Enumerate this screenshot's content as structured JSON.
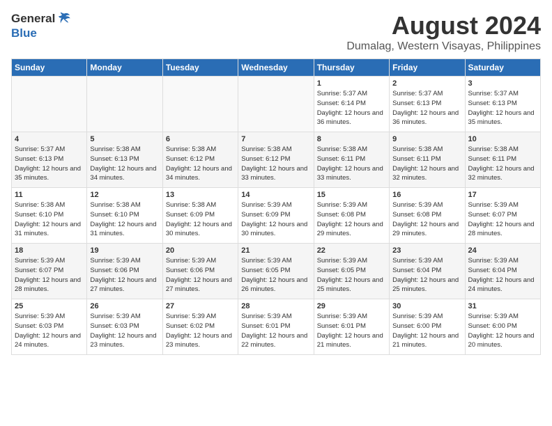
{
  "header": {
    "logo_general": "General",
    "logo_blue": "Blue",
    "title": "August 2024",
    "subtitle": "Dumalag, Western Visayas, Philippines"
  },
  "days_of_week": [
    "Sunday",
    "Monday",
    "Tuesday",
    "Wednesday",
    "Thursday",
    "Friday",
    "Saturday"
  ],
  "weeks": [
    [
      {
        "day": "",
        "empty": true
      },
      {
        "day": "",
        "empty": true
      },
      {
        "day": "",
        "empty": true
      },
      {
        "day": "",
        "empty": true
      },
      {
        "day": "1",
        "sunrise": "5:37 AM",
        "sunset": "6:14 PM",
        "daylight": "12 hours and 36 minutes."
      },
      {
        "day": "2",
        "sunrise": "5:37 AM",
        "sunset": "6:13 PM",
        "daylight": "12 hours and 36 minutes."
      },
      {
        "day": "3",
        "sunrise": "5:37 AM",
        "sunset": "6:13 PM",
        "daylight": "12 hours and 35 minutes."
      }
    ],
    [
      {
        "day": "4",
        "sunrise": "5:37 AM",
        "sunset": "6:13 PM",
        "daylight": "12 hours and 35 minutes."
      },
      {
        "day": "5",
        "sunrise": "5:38 AM",
        "sunset": "6:13 PM",
        "daylight": "12 hours and 34 minutes."
      },
      {
        "day": "6",
        "sunrise": "5:38 AM",
        "sunset": "6:12 PM",
        "daylight": "12 hours and 34 minutes."
      },
      {
        "day": "7",
        "sunrise": "5:38 AM",
        "sunset": "6:12 PM",
        "daylight": "12 hours and 33 minutes."
      },
      {
        "day": "8",
        "sunrise": "5:38 AM",
        "sunset": "6:11 PM",
        "daylight": "12 hours and 33 minutes."
      },
      {
        "day": "9",
        "sunrise": "5:38 AM",
        "sunset": "6:11 PM",
        "daylight": "12 hours and 32 minutes."
      },
      {
        "day": "10",
        "sunrise": "5:38 AM",
        "sunset": "6:11 PM",
        "daylight": "12 hours and 32 minutes."
      }
    ],
    [
      {
        "day": "11",
        "sunrise": "5:38 AM",
        "sunset": "6:10 PM",
        "daylight": "12 hours and 31 minutes."
      },
      {
        "day": "12",
        "sunrise": "5:38 AM",
        "sunset": "6:10 PM",
        "daylight": "12 hours and 31 minutes."
      },
      {
        "day": "13",
        "sunrise": "5:38 AM",
        "sunset": "6:09 PM",
        "daylight": "12 hours and 30 minutes."
      },
      {
        "day": "14",
        "sunrise": "5:39 AM",
        "sunset": "6:09 PM",
        "daylight": "12 hours and 30 minutes."
      },
      {
        "day": "15",
        "sunrise": "5:39 AM",
        "sunset": "6:08 PM",
        "daylight": "12 hours and 29 minutes."
      },
      {
        "day": "16",
        "sunrise": "5:39 AM",
        "sunset": "6:08 PM",
        "daylight": "12 hours and 29 minutes."
      },
      {
        "day": "17",
        "sunrise": "5:39 AM",
        "sunset": "6:07 PM",
        "daylight": "12 hours and 28 minutes."
      }
    ],
    [
      {
        "day": "18",
        "sunrise": "5:39 AM",
        "sunset": "6:07 PM",
        "daylight": "12 hours and 28 minutes."
      },
      {
        "day": "19",
        "sunrise": "5:39 AM",
        "sunset": "6:06 PM",
        "daylight": "12 hours and 27 minutes."
      },
      {
        "day": "20",
        "sunrise": "5:39 AM",
        "sunset": "6:06 PM",
        "daylight": "12 hours and 27 minutes."
      },
      {
        "day": "21",
        "sunrise": "5:39 AM",
        "sunset": "6:05 PM",
        "daylight": "12 hours and 26 minutes."
      },
      {
        "day": "22",
        "sunrise": "5:39 AM",
        "sunset": "6:05 PM",
        "daylight": "12 hours and 25 minutes."
      },
      {
        "day": "23",
        "sunrise": "5:39 AM",
        "sunset": "6:04 PM",
        "daylight": "12 hours and 25 minutes."
      },
      {
        "day": "24",
        "sunrise": "5:39 AM",
        "sunset": "6:04 PM",
        "daylight": "12 hours and 24 minutes."
      }
    ],
    [
      {
        "day": "25",
        "sunrise": "5:39 AM",
        "sunset": "6:03 PM",
        "daylight": "12 hours and 24 minutes."
      },
      {
        "day": "26",
        "sunrise": "5:39 AM",
        "sunset": "6:03 PM",
        "daylight": "12 hours and 23 minutes."
      },
      {
        "day": "27",
        "sunrise": "5:39 AM",
        "sunset": "6:02 PM",
        "daylight": "12 hours and 23 minutes."
      },
      {
        "day": "28",
        "sunrise": "5:39 AM",
        "sunset": "6:01 PM",
        "daylight": "12 hours and 22 minutes."
      },
      {
        "day": "29",
        "sunrise": "5:39 AM",
        "sunset": "6:01 PM",
        "daylight": "12 hours and 21 minutes."
      },
      {
        "day": "30",
        "sunrise": "5:39 AM",
        "sunset": "6:00 PM",
        "daylight": "12 hours and 21 minutes."
      },
      {
        "day": "31",
        "sunrise": "5:39 AM",
        "sunset": "6:00 PM",
        "daylight": "12 hours and 20 minutes."
      }
    ]
  ]
}
